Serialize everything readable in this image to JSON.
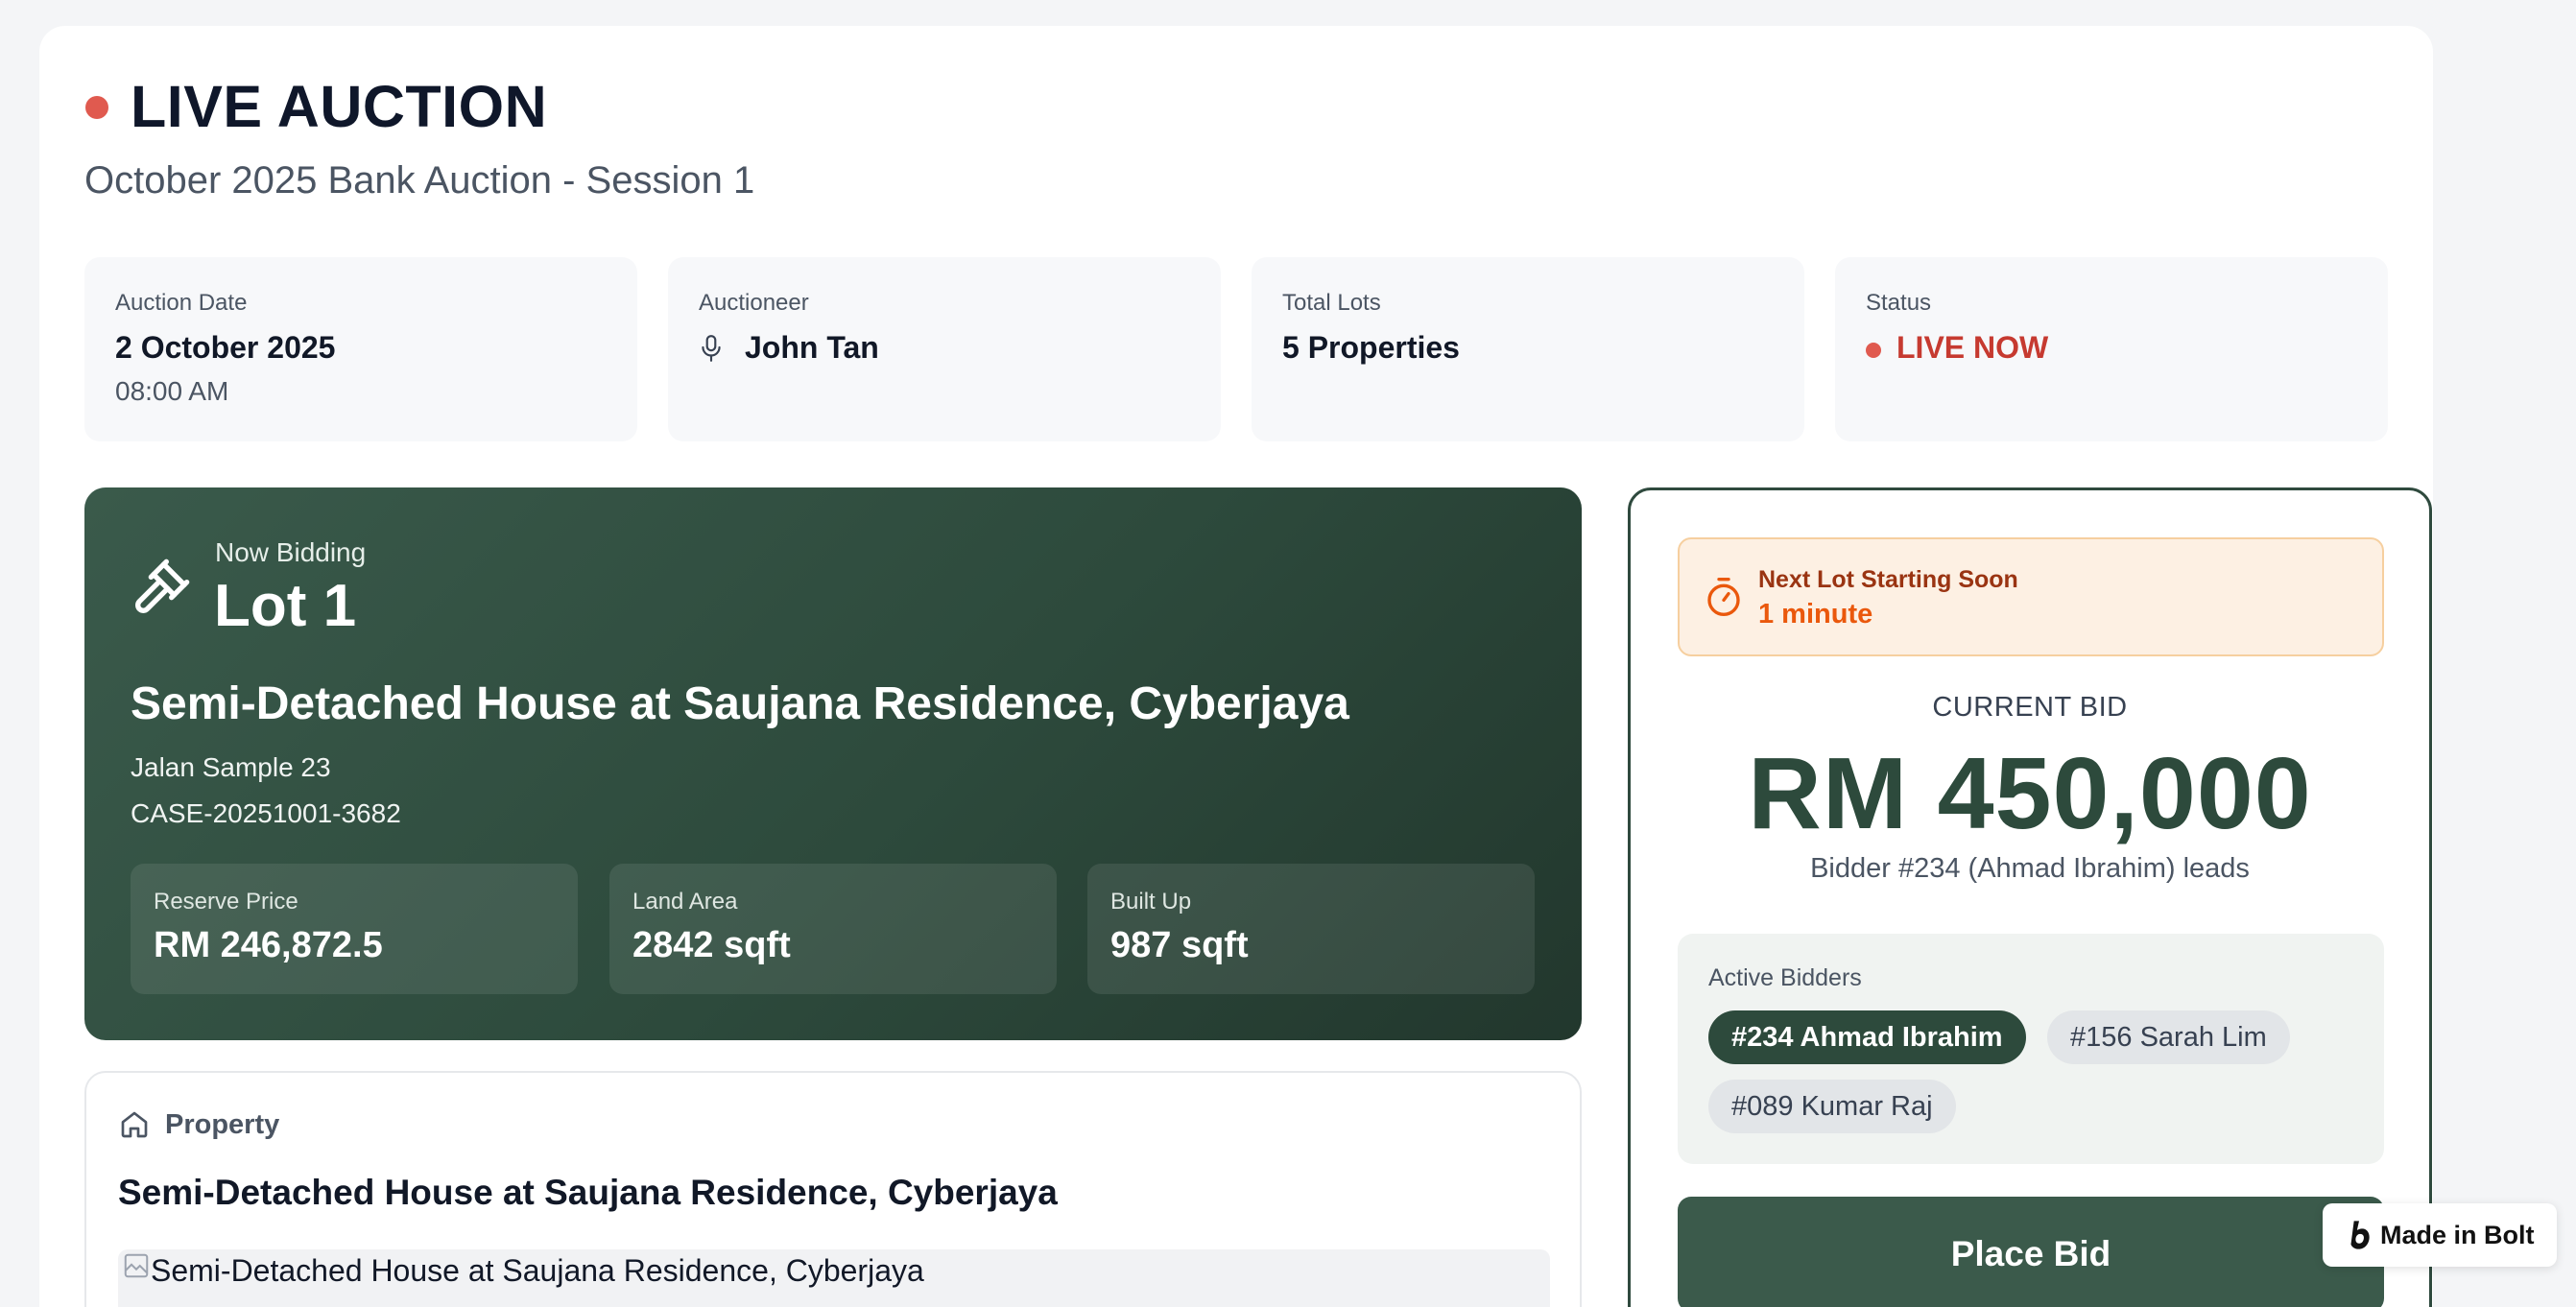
{
  "header": {
    "title": "LIVE AUCTION",
    "subtitle": "October 2025 Bank Auction - Session 1"
  },
  "info": {
    "auction_date": {
      "label": "Auction Date",
      "value": "2 October 2025",
      "time": "08:00 AM"
    },
    "auctioneer": {
      "label": "Auctioneer",
      "value": "John Tan",
      "icon": "microphone-icon"
    },
    "total_lots": {
      "label": "Total Lots",
      "value": "5 Properties"
    },
    "status": {
      "label": "Status",
      "value": "LIVE NOW",
      "color": "#c63a30"
    }
  },
  "now_bidding": {
    "label": "Now Bidding",
    "lot": "Lot 1",
    "property_title": "Semi-Detached House at Saujana Residence, Cyberjaya",
    "address": "Jalan Sample 23",
    "case_no": "CASE-20251001-3682",
    "stats": [
      {
        "label": "Reserve Price",
        "value": "RM 246,872.5"
      },
      {
        "label": "Land Area",
        "value": "2842 sqft"
      },
      {
        "label": "Built Up",
        "value": "987 sqft"
      }
    ]
  },
  "property": {
    "section_label": "Property",
    "name": "Semi-Detached House at Saujana Residence, Cyberjaya",
    "image_alt": "Semi-Detached House at Saujana Residence, Cyberjaya"
  },
  "bid_panel": {
    "next_lot_label": "Next Lot Starting Soon",
    "next_lot_value": "1 minute",
    "current_bid_label": "CURRENT BID",
    "current_bid": "RM 450,000",
    "leader": "Bidder #234 (Ahmad Ibrahim) leads",
    "active_bidders_label": "Active Bidders",
    "bidders": [
      "#234 Ahmad Ibrahim",
      "#156 Sarah Lim",
      "#089 Kumar Raj"
    ],
    "place_bid_label": "Place Bid"
  },
  "badge": {
    "label": "Made in Bolt"
  },
  "colors": {
    "accent": "#2d4a3c",
    "live": "#e05a4f",
    "warning": "#ea580c"
  }
}
